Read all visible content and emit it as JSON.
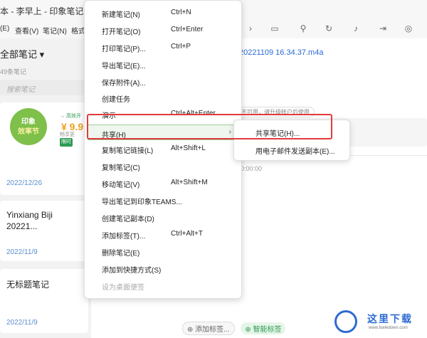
{
  "window": {
    "title": "本 - 李早上 - 印象笔记"
  },
  "menubar": {
    "items": [
      "(E)",
      "查看(V)",
      "笔记(N)",
      "格式"
    ]
  },
  "toolbar": {
    "icons": [
      "chevron-right-icon",
      "presentation-icon",
      "pin-icon",
      "refresh-icon",
      "bell-icon",
      "export-icon",
      "target-icon"
    ]
  },
  "notelist": {
    "header": "全部笔记 ▾",
    "count": "49条笔记",
    "search_placeholder": "搜索笔记",
    "promo": {
      "badge_line1": "印象",
      "badge_line2": "效率节",
      "line1": "→ 高效开",
      "line2": "¥ 9.9",
      "line3": "畅享更",
      "button": "限时"
    },
    "cards": [
      {
        "title": "",
        "date": "2022/12/26"
      },
      {
        "title": "Yinxiang Biji 20221...",
        "date": "2022/11/9"
      },
      {
        "title": "无标题笔记",
        "date": "2022/11/9"
      }
    ]
  },
  "editor": {
    "filename": "20221109 16.34.37.m4a",
    "hint": "不可用，请升级帐户后使用",
    "time": "0:00:00",
    "tag_add": "⊕ 添加标签...",
    "tag_smart": "⊕ 智能标签"
  },
  "context_menu": {
    "items": [
      {
        "label": "新建笔记(N)",
        "shortcut": "Ctrl+N"
      },
      {
        "label": "打开笔记(O)",
        "shortcut": "Ctrl+Enter"
      },
      {
        "label": "打印笔记(P)...",
        "shortcut": "Ctrl+P"
      },
      {
        "label": "导出笔记(E)...",
        "shortcut": ""
      },
      {
        "label": "保存附件(A)...",
        "shortcut": ""
      },
      {
        "label": "创建任务",
        "shortcut": ""
      },
      {
        "label": "演示",
        "shortcut": "Ctrl+Alt+Enter"
      },
      {
        "label": "共享(H)",
        "shortcut": ""
      },
      {
        "label": "复制笔记链接(L)",
        "shortcut": "Alt+Shift+L"
      },
      {
        "label": "复制笔记(C)",
        "shortcut": ""
      },
      {
        "label": "移动笔记(V)",
        "shortcut": "Alt+Shift+M"
      },
      {
        "label": "导出笔记到印象TEAMS...",
        "shortcut": ""
      },
      {
        "label": "创建笔记副本(D)",
        "shortcut": ""
      },
      {
        "label": "添加标签(T)...",
        "shortcut": "Ctrl+Alt+T"
      },
      {
        "label": "删除笔记(E)",
        "shortcut": ""
      },
      {
        "label": "添加到快捷方式(S)",
        "shortcut": ""
      },
      {
        "label": "设为桌面便签",
        "shortcut": ""
      }
    ]
  },
  "submenu": {
    "items": [
      {
        "label": "共享笔记(H)..."
      },
      {
        "label": "用电子邮件发送副本(E)..."
      }
    ]
  },
  "watermark": {
    "text": "这里下载",
    "url": "www.fueledown.com"
  }
}
